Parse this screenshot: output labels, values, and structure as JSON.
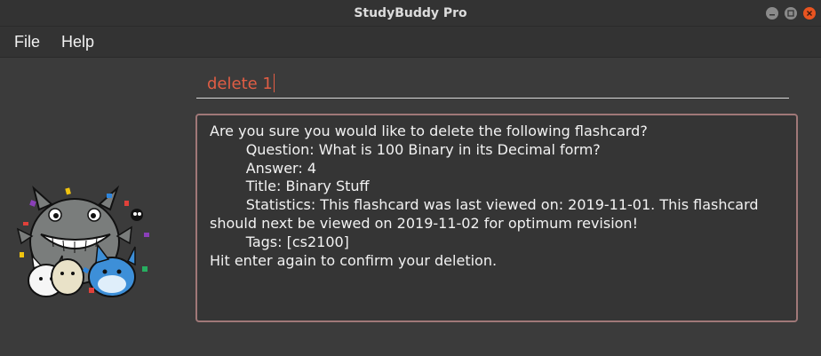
{
  "window": {
    "title": "StudyBuddy Pro",
    "controls": [
      "minimize-icon",
      "maximize-icon",
      "close-icon"
    ]
  },
  "menubar": {
    "items": [
      {
        "label": "File"
      },
      {
        "label": "Help"
      }
    ]
  },
  "command": {
    "value": "delete 1"
  },
  "result": {
    "text": "Are you sure you would like to delete the following flashcard?\n        Question: What is 100 Binary in its Decimal form?\n        Answer: 4\n        Title: Binary Stuff\n        Statistics: This flashcard was last viewed on: 2019-11-01. This flashcard should next be viewed on 2019-11-02 for optimum revision!\n        Tags: [cs2100]\nHit enter again to confirm your deletion."
  },
  "colors": {
    "background": "#3b3b3b",
    "command_text": "#e05d44",
    "result_border": "#a07878",
    "close_button": "#e95420"
  },
  "mascot": {
    "icon": "totoro-mascot-icon"
  }
}
